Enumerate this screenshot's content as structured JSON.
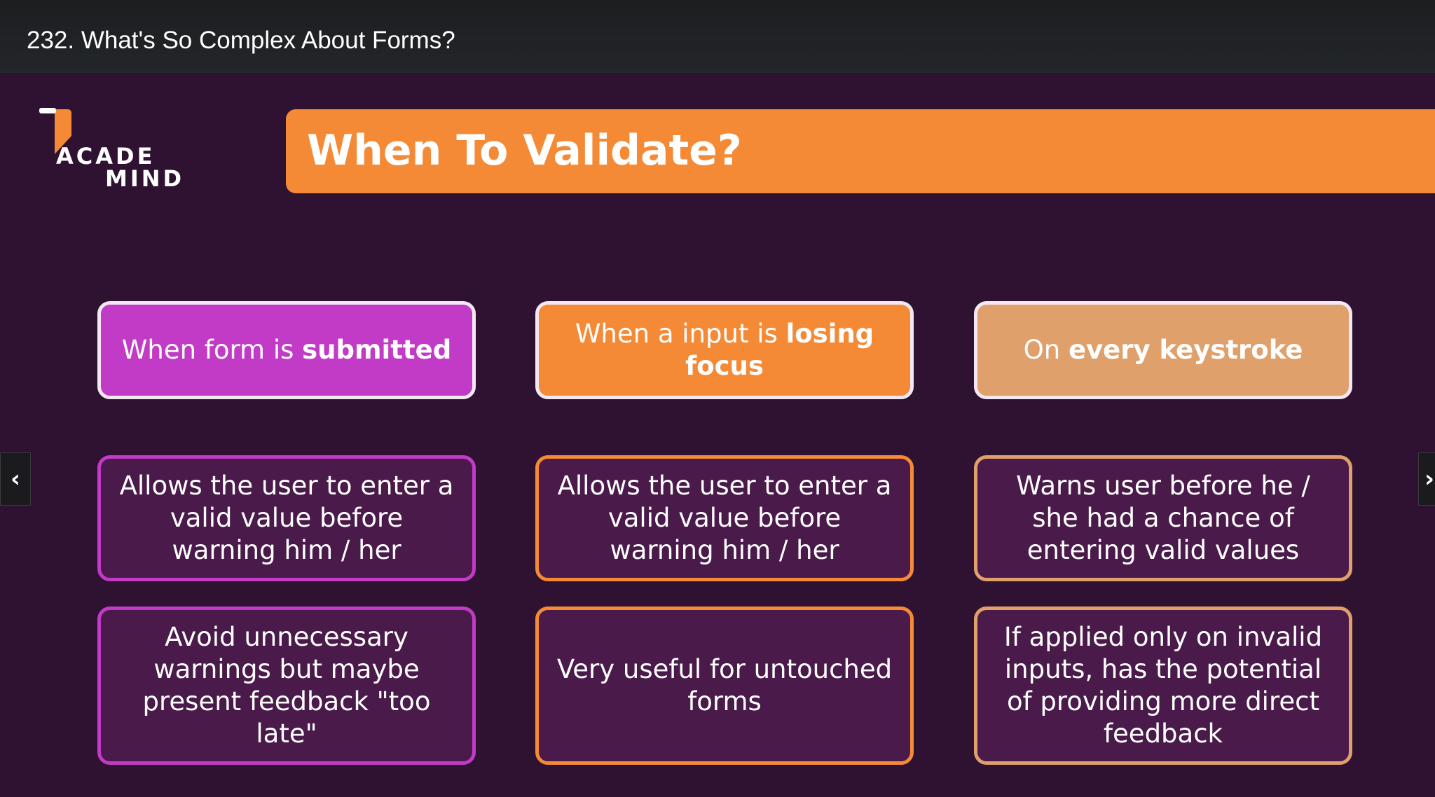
{
  "header": {
    "title": "232. What's So Complex About Forms?"
  },
  "logo": {
    "line1": "ACADE",
    "line2": "MIND",
    "colors": {
      "mark": "#f58a36"
    }
  },
  "slide": {
    "title": "When To Validate?",
    "columns": [
      {
        "heading_pre": "When form is ",
        "heading_bold": "submitted",
        "points": [
          "Allows the user to enter a valid value before warning him / her",
          "Avoid unnecessary warnings but maybe present feedback \"too late\""
        ]
      },
      {
        "heading_pre": "When a input is ",
        "heading_bold": "losing focus",
        "points": [
          "Allows the user to enter a valid value before warning him / her",
          "Very useful for untouched forms"
        ]
      },
      {
        "heading_pre": "On ",
        "heading_bold": "every keystroke",
        "points": [
          "Warns user before he / she had a chance of entering valid values",
          "If applied only on invalid inputs, has the potential of providing more direct feedback"
        ]
      }
    ],
    "colors": {
      "purple": "#c23bc6",
      "orange": "#f58a36",
      "peach": "#e0a06c",
      "background": "#2f1131"
    }
  },
  "nav": {
    "prev_icon": "chevron-left-icon",
    "next_icon": "chevron-right-icon",
    "prev_glyph": "‹",
    "next_glyph": "›"
  }
}
